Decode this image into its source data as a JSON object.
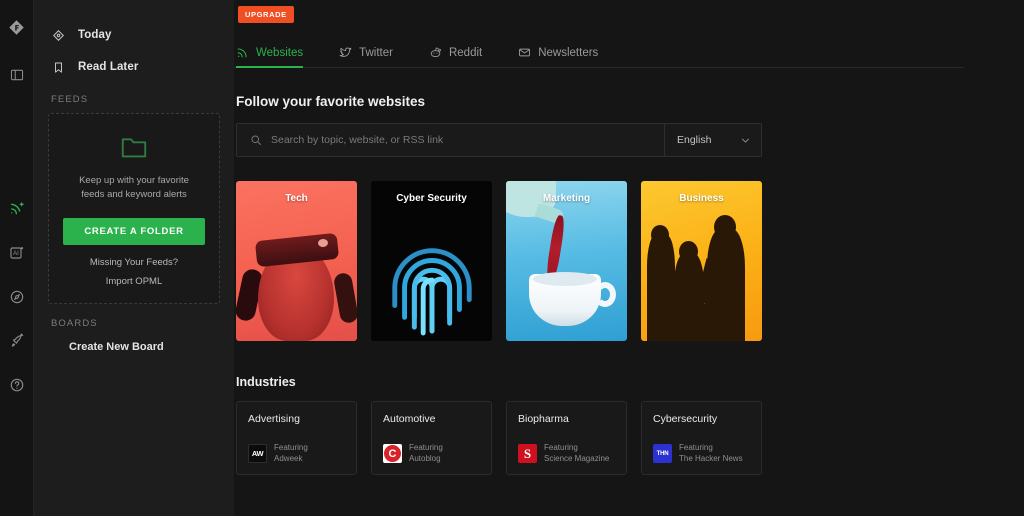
{
  "rail": {
    "items": [
      {
        "name": "feedly-logo",
        "icon": "feedly-logo-icon"
      },
      {
        "name": "toggle-panel",
        "icon": "panel-toggle-icon"
      },
      {
        "name": "feeds",
        "icon": "rss-plus-icon"
      },
      {
        "name": "ai-feeds",
        "icon": "ai-box-icon"
      },
      {
        "name": "discover",
        "icon": "compass-icon"
      },
      {
        "name": "boosts",
        "icon": "rocket-icon"
      },
      {
        "name": "help",
        "icon": "question-circle-icon"
      }
    ]
  },
  "sidebar": {
    "nav": [
      {
        "label": "Today",
        "icon": "gem-icon"
      },
      {
        "label": "Read Later",
        "icon": "bookmark-icon"
      }
    ],
    "feeds_section_title": "FEEDS",
    "feeds_card": {
      "folder_icon": "folder-outline-icon",
      "message": "Keep up with your favorite feeds and keyword alerts",
      "create_button": "CREATE A FOLDER",
      "missing_feeds_link": "Missing Your Feeds?",
      "import_link": "Import OPML"
    },
    "boards_section_title": "BOARDS",
    "create_board": "Create New Board"
  },
  "topbar": {
    "upgrade_label": "UPGRADE"
  },
  "tabs": [
    {
      "label": "Websites",
      "icon": "rss-icon",
      "active": true
    },
    {
      "label": "Twitter",
      "icon": "twitter-bird-icon",
      "active": false
    },
    {
      "label": "Reddit",
      "icon": "reddit-alien-icon",
      "active": false
    },
    {
      "label": "Newsletters",
      "icon": "envelope-icon",
      "active": false
    }
  ],
  "main": {
    "heading": "Follow your favorite websites",
    "search": {
      "placeholder": "Search by topic, website, or RSS link",
      "value": "",
      "icon": "search-icon"
    },
    "language": {
      "selected": "English",
      "icon": "chevron-down-icon"
    },
    "categories": [
      {
        "title": "Tech",
        "accent": "#f4604f"
      },
      {
        "title": "Cyber Security",
        "accent": "#29a8df"
      },
      {
        "title": "Marketing",
        "accent": "#57bce4"
      },
      {
        "title": "Business",
        "accent": "#fbb116"
      }
    ],
    "industries_heading": "Industries",
    "industries": [
      {
        "name": "Advertising",
        "featuring_label": "Featuring",
        "featuring_source": "Adweek",
        "logo_text": "AW"
      },
      {
        "name": "Automotive",
        "featuring_label": "Featuring",
        "featuring_source": "Autoblog",
        "logo_text": "C"
      },
      {
        "name": "Biopharma",
        "featuring_label": "Featuring",
        "featuring_source": "Science Magazine",
        "logo_text": "S"
      },
      {
        "name": "Cybersecurity",
        "featuring_label": "Featuring",
        "featuring_source": "The Hacker News",
        "logo_text": "THN"
      }
    ]
  }
}
